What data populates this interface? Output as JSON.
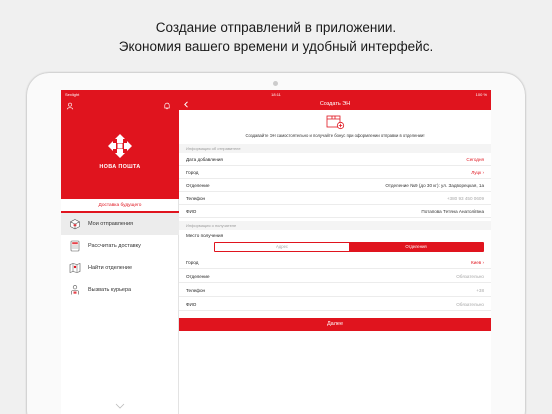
{
  "promo": {
    "line1": "Создание отправлений в приложении.",
    "line2": "Экономия вашего времени и удобный интерфейс."
  },
  "status_bar": {
    "carrier": "Sexlight",
    "time": "18:11",
    "battery": "100 %"
  },
  "sidebar": {
    "logo_text": "НОВА ПОШТА",
    "future_tab": "Доставка будущего",
    "items": [
      {
        "label": "Мои отправления",
        "icon": "parcel-icon",
        "active": true
      },
      {
        "label": "Рассчитать доставку",
        "icon": "calculator-icon",
        "active": false
      },
      {
        "label": "Найти отделение",
        "icon": "map-icon",
        "active": false
      },
      {
        "label": "Вызвать курьера",
        "icon": "courier-icon",
        "active": false
      }
    ]
  },
  "main": {
    "nav_title": "Создать ЭН",
    "banner_text": "Создавайте ЭН самостоятельно и получайте бонус при оформлении отправки в отделении!",
    "sender_section": "Информация об отправителе",
    "sender_rows": [
      {
        "label": "Дата добавления",
        "value": "Сегодня",
        "style": "red"
      },
      {
        "label": "Город",
        "value": "Луцк ›",
        "style": "red"
      },
      {
        "label": "Отделение",
        "value": "Отделение №9 (до 30 кг): ул. Задворецкая, 1а",
        "style": "normal"
      },
      {
        "label": "Телефон",
        "value": "+380 93 450 0609",
        "style": "gray"
      },
      {
        "label": "ФИО",
        "value": "Потапова Тетяна Анатоліївна",
        "style": "normal"
      }
    ],
    "recipient_section": "Информация о получателе",
    "place_label": "Место получения",
    "segment": {
      "address": "Адрес",
      "branch": "Отделения",
      "selected": "branch"
    },
    "recipient_rows": [
      {
        "label": "Город",
        "value": "Киев ›",
        "style": "red"
      },
      {
        "label": "Отделение",
        "value": "Обязательно",
        "style": "gray"
      },
      {
        "label": "Телефон",
        "value": "+38",
        "style": "gray"
      },
      {
        "label": "ФИО",
        "value": "Обязательно",
        "style": "gray"
      }
    ],
    "next_button": "Далее"
  },
  "colors": {
    "brand_red": "#e0141e",
    "background": "#f0f0f0",
    "divider": "#ececec"
  }
}
